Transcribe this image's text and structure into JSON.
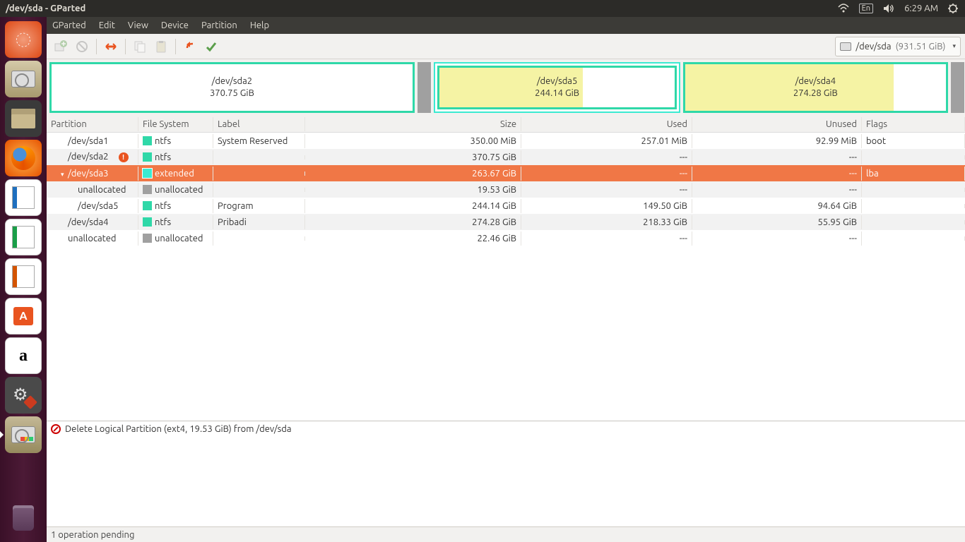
{
  "system_bar": {
    "title": "/dev/sda - GParted",
    "lang": "En",
    "time": "6:29 AM"
  },
  "menubar": {
    "items": [
      "GParted",
      "Edit",
      "View",
      "Device",
      "Partition",
      "Help"
    ]
  },
  "toolbar": {
    "device_name": "/dev/sda",
    "device_size": "(931.51 GiB)"
  },
  "part_map": [
    {
      "name": "/dev/sda2",
      "size": "370.75 GiB",
      "type": "primary",
      "fill_pct": 0,
      "width_pct": 40
    },
    {
      "name": "",
      "size": "",
      "type": "gap",
      "width_pct": 1.5
    },
    {
      "name": "/dev/sda5",
      "size": "244.14 GiB",
      "type": "logical-in-extended",
      "fill_pct": 61,
      "width_pct": 27,
      "extended_pad": true
    },
    {
      "name": "/dev/sda4",
      "size": "274.28 GiB",
      "type": "primary",
      "fill_pct": 80,
      "width_pct": 29
    },
    {
      "name": "",
      "size": "",
      "type": "gap",
      "width_pct": 1.5
    }
  ],
  "table": {
    "headers": {
      "partition": "Partition",
      "fs": "File System",
      "label": "Label",
      "size": "Size",
      "used": "Used",
      "unused": "Unused",
      "flags": "Flags"
    },
    "rows": [
      {
        "part": "/dev/sda1",
        "indent": 1,
        "fs": "ntfs",
        "fs_sw": "ntfs",
        "label": "System Reserved",
        "size": "350.00 MiB",
        "used": "257.01 MiB",
        "unused": "92.99 MiB",
        "flags": "boot",
        "warn": false,
        "striped": false
      },
      {
        "part": "/dev/sda2",
        "indent": 1,
        "fs": "ntfs",
        "fs_sw": "ntfs",
        "label": "",
        "size": "370.75 GiB",
        "used": "---",
        "unused": "---",
        "flags": "",
        "warn": true,
        "striped": true
      },
      {
        "part": "/dev/sda3",
        "indent": 1,
        "fs": "extended",
        "fs_sw": "ext",
        "label": "",
        "size": "263.67 GiB",
        "used": "---",
        "unused": "---",
        "flags": "lba",
        "warn": false,
        "selected": true,
        "expander": true
      },
      {
        "part": "unallocated",
        "indent": 2,
        "fs": "unallocated",
        "fs_sw": "unalloc",
        "label": "",
        "size": "19.53 GiB",
        "used": "---",
        "unused": "---",
        "flags": "",
        "warn": false,
        "striped": true
      },
      {
        "part": "/dev/sda5",
        "indent": 2,
        "fs": "ntfs",
        "fs_sw": "ntfs",
        "label": "Program",
        "size": "244.14 GiB",
        "used": "149.50 GiB",
        "unused": "94.64 GiB",
        "flags": "",
        "warn": false,
        "striped": false
      },
      {
        "part": "/dev/sda4",
        "indent": 1,
        "fs": "ntfs",
        "fs_sw": "ntfs",
        "label": "Pribadi",
        "size": "274.28 GiB",
        "used": "218.33 GiB",
        "unused": "55.95 GiB",
        "flags": "",
        "warn": false,
        "striped": true
      },
      {
        "part": "unallocated",
        "indent": 1,
        "fs": "unallocated",
        "fs_sw": "unalloc",
        "label": "",
        "size": "22.46 GiB",
        "used": "---",
        "unused": "---",
        "flags": "",
        "warn": false,
        "striped": false
      }
    ]
  },
  "pending_ops": [
    {
      "text": "Delete Logical Partition (ext4, 19.53 GiB) from /dev/sda"
    }
  ],
  "status_bar": {
    "text": "1 operation pending"
  }
}
